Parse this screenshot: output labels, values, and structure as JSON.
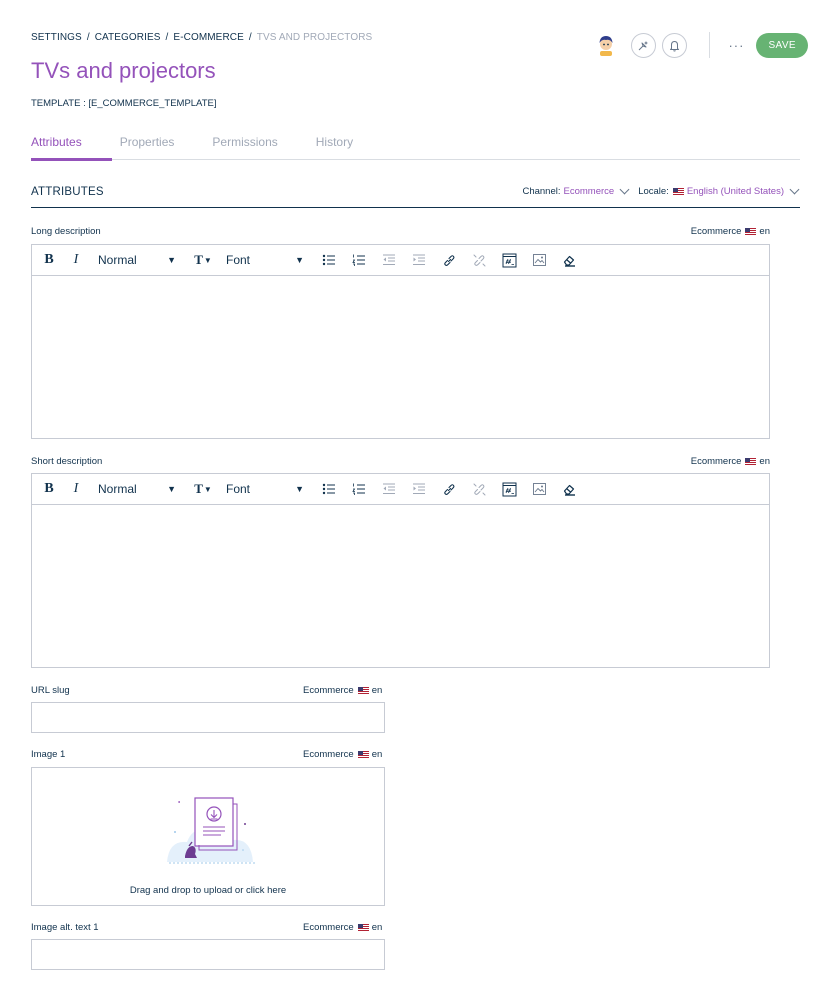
{
  "breadcrumb": {
    "items": [
      "SETTINGS",
      "CATEGORIES",
      "E-COMMERCE"
    ],
    "separator": "/",
    "current": "TVS AND PROJECTORS"
  },
  "page": {
    "title": "TVs and projectors",
    "template_label": "TEMPLATE :",
    "template_value": "[E_COMMERCE_TEMPLATE]"
  },
  "header": {
    "more_label": "···",
    "save_label": "SAVE"
  },
  "tabs": [
    {
      "label": "Attributes",
      "active": true
    },
    {
      "label": "Properties",
      "active": false
    },
    {
      "label": "Permissions",
      "active": false
    },
    {
      "label": "History",
      "active": false
    }
  ],
  "section": {
    "title": "ATTRIBUTES",
    "channel_label": "Channel:",
    "channel_value": "Ecommerce",
    "locale_label": "Locale:",
    "locale_value": "English (United States)"
  },
  "toolbar": {
    "bold": "B",
    "italic": "I",
    "paragraph_style": "Normal",
    "font": "Font",
    "text_size": "T",
    "dropdown_arrow": "▼"
  },
  "fields": {
    "long_description": {
      "label": "Long description",
      "channel": "Ecommerce",
      "locale": "en",
      "value": ""
    },
    "short_description": {
      "label": "Short description",
      "channel": "Ecommerce",
      "locale": "en",
      "value": ""
    },
    "url_slug": {
      "label": "URL slug",
      "channel": "Ecommerce",
      "locale": "en",
      "value": ""
    },
    "image_1": {
      "label": "Image 1",
      "channel": "Ecommerce",
      "locale": "en",
      "upload_text": "Drag and drop to upload or click here"
    },
    "image_alt_text_1": {
      "label": "Image alt. text 1",
      "channel": "Ecommerce",
      "locale": "en",
      "value": ""
    }
  },
  "colors": {
    "accent": "#9452ba",
    "text": "#11324d",
    "muted": "#a1a9b7",
    "border": "#c7cbd4",
    "save": "#67b373"
  },
  "icons": [
    "avatar-icon",
    "activity-icon",
    "bell-icon",
    "bullet-list-icon",
    "numbered-list-icon",
    "indent-icon",
    "outdent-icon",
    "link-icon",
    "unlink-icon",
    "embed-icon",
    "image-icon",
    "eraser-icon",
    "upload-illustration",
    "us-flag-icon",
    "chevron-down-icon"
  ]
}
